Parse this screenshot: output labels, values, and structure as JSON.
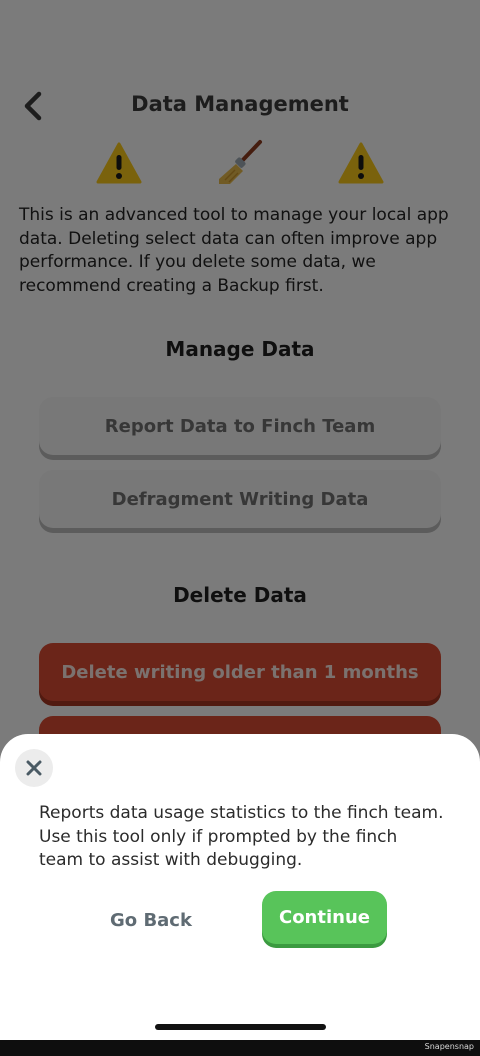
{
  "header": {
    "title": "Data Management",
    "back_icon": "chevron-left-icon"
  },
  "icons": [
    "warning-icon",
    "broom-icon",
    "warning-icon"
  ],
  "intro_text": "This is an advanced tool to manage your local app data. Deleting select data can often improve app performance. If you delete some data, we recommend creating a Backup first.",
  "manage_section": {
    "title": "Manage Data",
    "buttons": [
      "Report Data to Finch Team",
      "Defragment Writing Data"
    ]
  },
  "delete_section": {
    "title": "Delete Data",
    "buttons": [
      "Delete writing older than 1 months"
    ]
  },
  "sheet": {
    "description": "Reports data usage statistics to the finch team. Use this tool only if prompted by the finch team to assist with debugging.",
    "go_back_label": "Go Back",
    "continue_label": "Continue",
    "close_icon": "close-icon"
  },
  "watermark": "Snapensnap",
  "colors": {
    "accent_green": "#58c45a",
    "danger_red": "#d74a32",
    "warning_yellow": "#f5c518"
  }
}
